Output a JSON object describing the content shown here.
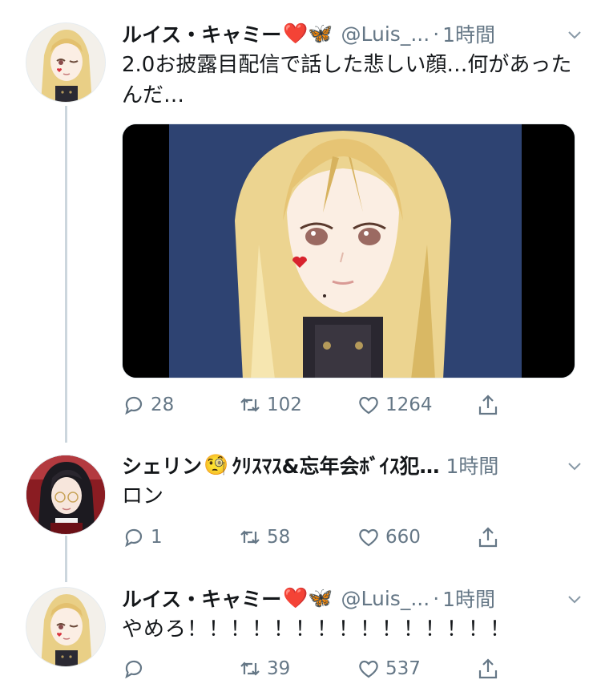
{
  "tweets": [
    {
      "name": "ルイス・キャミー",
      "emoji": "❤️🦋",
      "handle": "@Luis_...",
      "dot": "·",
      "time": "1時間",
      "text": "2.0お披露目配信で話した悲しい顔…何があったんだ…",
      "replies": "28",
      "retweets": "102",
      "likes": "1264",
      "avatar": "blonde-character-avatar",
      "has_media": true
    },
    {
      "name": "シェリン",
      "emoji": "🧐",
      "handle": "ｸﾘｽﾏｽ&忘年会ﾎﾞｲｽ犯…",
      "dot": "",
      "time": "1時間",
      "text": "ロン",
      "replies": "1",
      "retweets": "58",
      "likes": "660",
      "avatar": "dark-haired-character-avatar"
    },
    {
      "name": "ルイス・キャミー",
      "emoji": "❤️🦋",
      "handle": "@Luis_...",
      "dot": "·",
      "time": "1時間",
      "text": "やめろ！！！！！！！！！！！！！！！",
      "replies": "",
      "retweets": "39",
      "likes": "537",
      "avatar": "blonde-character-avatar"
    }
  ],
  "icons": {
    "reply": "reply-icon",
    "retweet": "retweet-icon",
    "like": "heart-icon",
    "share": "share-icon",
    "menu": "chevron-down-icon"
  },
  "colors": {
    "text": "#14171a",
    "secondary": "#657786",
    "thread_line": "#ccd6dd",
    "media_bg": "#2e4372"
  }
}
